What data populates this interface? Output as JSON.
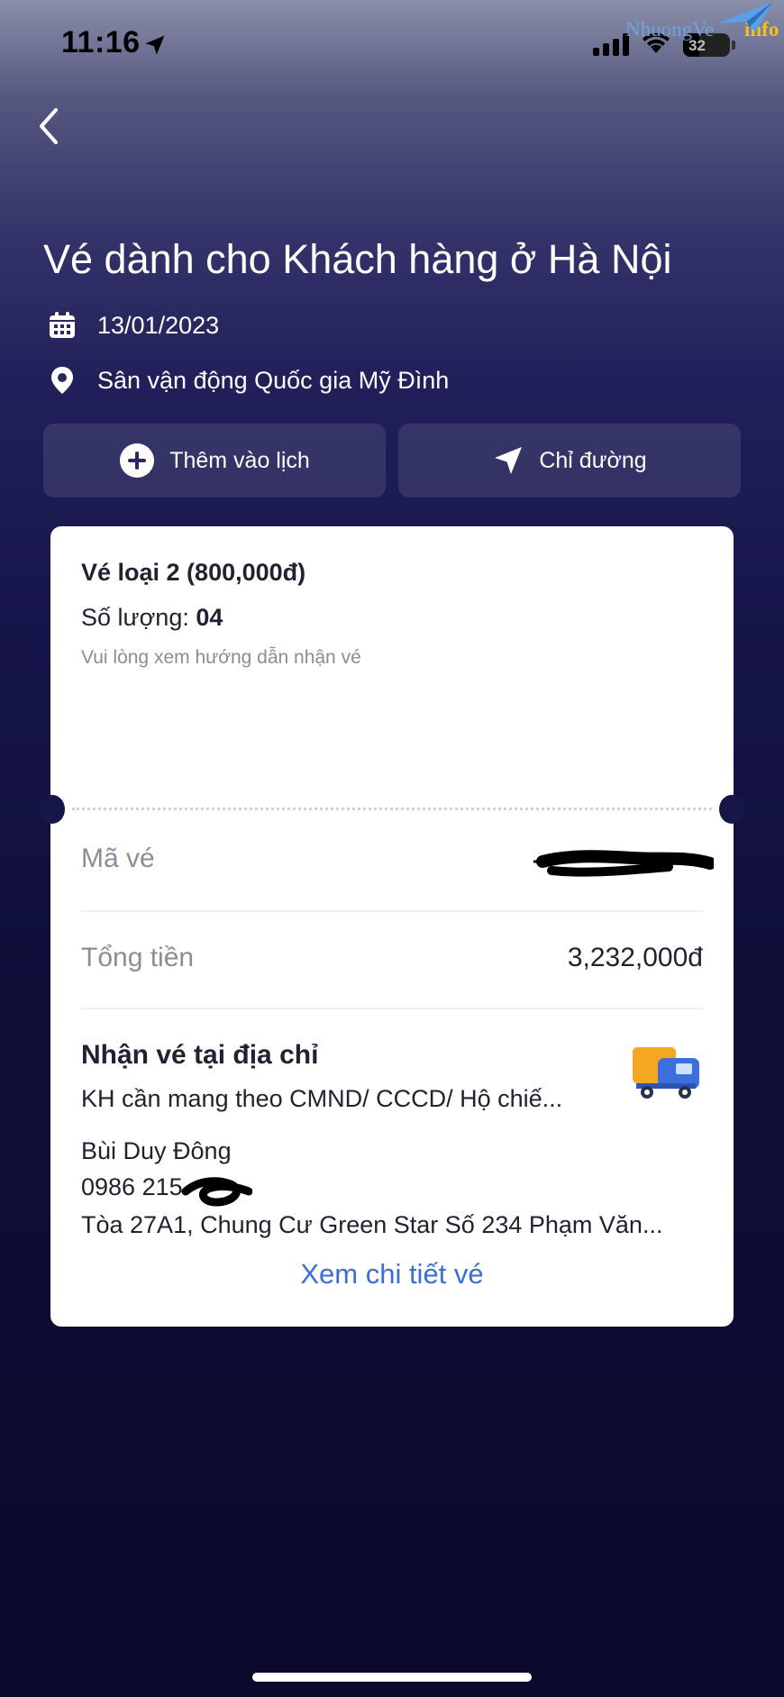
{
  "status_bar": {
    "time": "11:16",
    "battery": "32"
  },
  "watermark": {
    "brand": "NhuongVe",
    "suffix": "info"
  },
  "header": {
    "title": "Vé dành cho Khách hàng ở Hà Nội",
    "date": "13/01/2023",
    "venue": "Sân vận động Quốc gia Mỹ Đình"
  },
  "actions": {
    "add_calendar": "Thêm vào lịch",
    "directions": "Chỉ đường"
  },
  "ticket": {
    "type": "Vé loại 2 (800,000đ)",
    "quantity_label": "Số lượng:",
    "quantity": "04",
    "hint": "Vui lòng xem hướng dẫn nhận vé",
    "code_label": "Mã vé",
    "total_label": "Tổng tiền",
    "total_value": "3,232,000đ"
  },
  "delivery": {
    "title": "Nhận vé tại địa chỉ",
    "note": "KH cần mang theo CMND/ CCCD/ Hộ chiế...",
    "recipient": "Bùi Duy Đông",
    "phone": "0986 215",
    "address": "Tòa 27A1, Chung Cư Green Star Số 234 Phạm Văn...",
    "detail_link": "Xem chi tiết vé"
  },
  "colors": {
    "accent_link": "#3b6fd8",
    "card_bg": "#ffffff",
    "page_bg_bottom": "#0b0a2c"
  }
}
